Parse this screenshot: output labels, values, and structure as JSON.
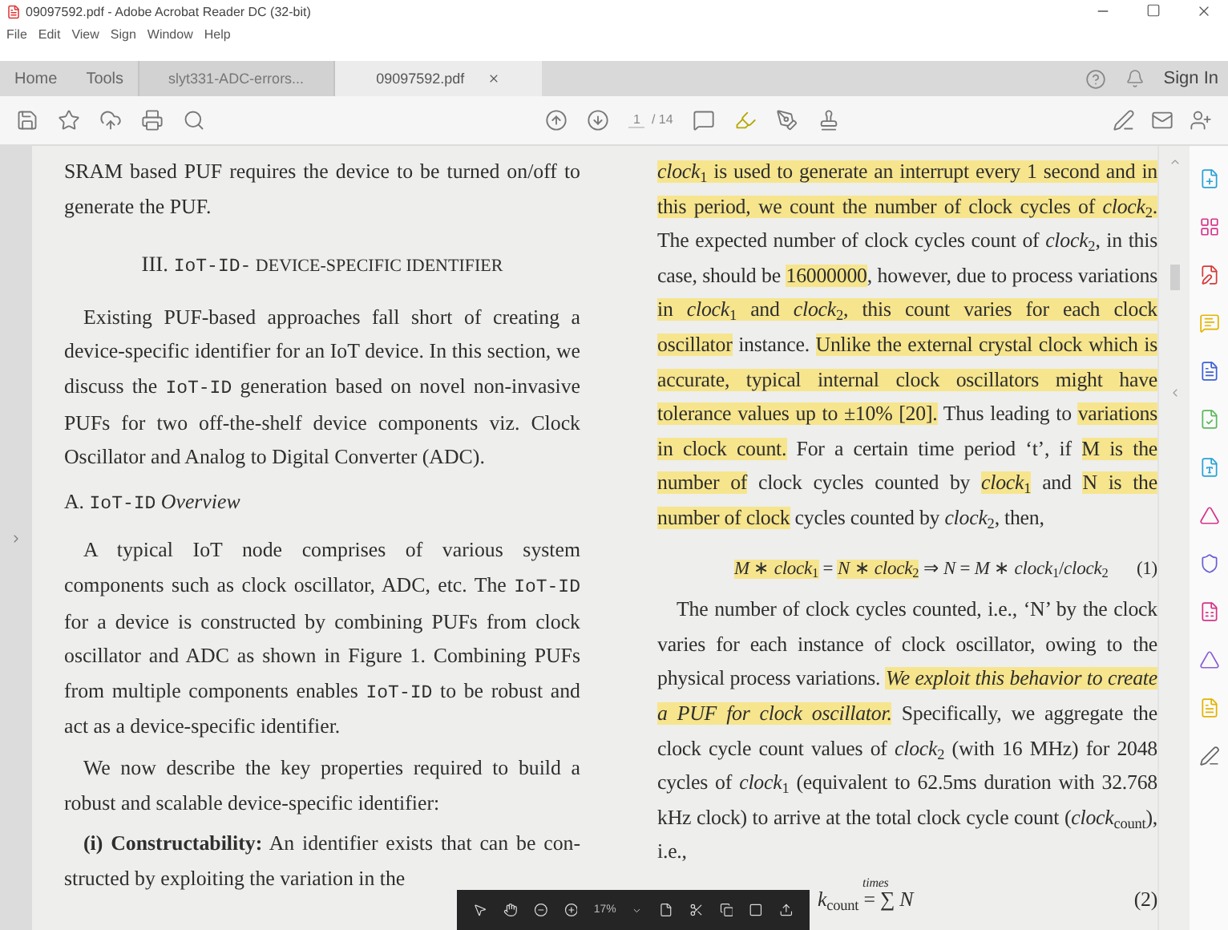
{
  "window": {
    "title": "09097592.pdf - Adobe Acrobat Reader DC (32-bit)"
  },
  "menu": [
    "File",
    "Edit",
    "View",
    "Sign",
    "Window",
    "Help"
  ],
  "nav": [
    "Home",
    "Tools"
  ],
  "tabs": [
    {
      "label": "slyt331-ADC-errors...",
      "selected": false
    },
    {
      "label": "09097592.pdf",
      "selected": true
    }
  ],
  "sign_in": "Sign In",
  "page_nav": {
    "current": "1",
    "total": "/ 14"
  },
  "document": {
    "left_column": [
      {
        "kind": "paragraph",
        "indent": false,
        "runs": [
          {
            "text": "SRAM based PUF requires the device to be turned on/off to generate the PUF.",
            "kind": "plain"
          }
        ]
      },
      {
        "kind": "heading",
        "runs": [
          {
            "text": "III. ",
            "kind": "plain"
          },
          {
            "text": "IoT-ID-",
            "kind": "mono"
          },
          {
            "text": " DEVICE-SPECIFIC IDENTIFIER",
            "kind": "caps"
          }
        ]
      },
      {
        "kind": "paragraph",
        "indent": true,
        "runs": [
          {
            "text": "Existing PUF-based approaches fall short of creating a device-specific identifier for an IoT device. In this section, we discuss the ",
            "kind": "plain"
          },
          {
            "text": "IoT-ID",
            "kind": "mono"
          },
          {
            "text": " generation based on novel non-invasive PUFs for two off-the-shelf device components viz. Clock Oscillator and Analog to Digital Converter (ADC).",
            "kind": "plain"
          }
        ]
      },
      {
        "kind": "subheading",
        "runs": [
          {
            "text": "A. ",
            "kind": "plain"
          },
          {
            "text": "IoT-ID",
            "kind": "mono"
          },
          {
            "text": " Overview",
            "kind": "italic"
          }
        ]
      },
      {
        "kind": "paragraph",
        "indent": true,
        "runs": [
          {
            "text": "A typical IoT node comprises of various system components such as clock oscillator, ADC, etc. The ",
            "kind": "plain"
          },
          {
            "text": "IoT-ID",
            "kind": "mono"
          },
          {
            "text": " for a device is constructed by combining PUFs from clock oscillator and ADC as shown in Figure 1. Combining PUFs from multiple components enables ",
            "kind": "plain"
          },
          {
            "text": "IoT-ID",
            "kind": "mono"
          },
          {
            "text": " to be robust and act as a device-specific identifier.",
            "kind": "plain"
          }
        ]
      },
      {
        "kind": "paragraph",
        "indent": true,
        "runs": [
          {
            "text": "We now describe the key properties required to build a robust and scalable device-specific identifier:",
            "kind": "plain"
          }
        ]
      },
      {
        "kind": "paragraph",
        "indent": true,
        "runs": [
          {
            "text": "(i) Constructability:",
            "kind": "bold"
          },
          {
            "text": " An identifier exists that can be con-structed by exploiting the variation in the",
            "kind": "plain"
          }
        ]
      }
    ],
    "right_column": [
      {
        "kind": "paragraph",
        "indent": false,
        "runs": [
          {
            "text": "*clock*$_{1}$ is used to generate an interrupt every 1 second and in this period, we count the number of clock cycles of *clock*$_{2}$.",
            "kind": "plain",
            "highlighted": true
          },
          {
            "text": " The expected number of clock cycles count of *clock*$_{2}$, in this case, should be ",
            "kind": "plain",
            "highlighted": false
          },
          {
            "text": "16000000",
            "kind": "plain",
            "highlighted": true
          },
          {
            "text": ", however, due to process variations ",
            "kind": "plain",
            "highlighted": false
          },
          {
            "text": "in *clock*$_{1}$ and *clock*$_{2}$, this count varies for each clock oscillator",
            "kind": "plain",
            "highlighted": true
          },
          {
            "text": " instance. ",
            "kind": "plain",
            "highlighted": false
          },
          {
            "text": "Unlike the external crystal clock which is accurate, typical internal clock oscillators might have tolerance values up to ±10% [20].",
            "kind": "plain",
            "highlighted": true
          },
          {
            "text": " Thus leading to ",
            "kind": "plain",
            "highlighted": false
          },
          {
            "text": "variations in clock count.",
            "kind": "plain",
            "highlighted": true
          },
          {
            "text": " For a certain time period ‘t’, if ",
            "kind": "plain",
            "highlighted": false
          },
          {
            "text": "M is the number of",
            "kind": "plain",
            "highlighted": true
          },
          {
            "text": " clock cycles counted by ",
            "kind": "plain",
            "highlighted": false
          },
          {
            "text": "*clock*$_{1}$",
            "kind": "plain",
            "highlighted": true
          },
          {
            "text": " and ",
            "kind": "plain",
            "highlighted": false
          },
          {
            "text": "N is the number of clock",
            "kind": "plain",
            "highlighted": true
          },
          {
            "text": " cycles counted by *clock*$_{2}$, then,",
            "kind": "plain",
            "highlighted": false
          }
        ]
      },
      {
        "kind": "equation",
        "number": "(1)",
        "runs": [
          {
            "text": "*M* ∗ *clock*$_{1}$",
            "kind": "plain",
            "highlighted": true
          },
          {
            "text": " = ",
            "kind": "plain",
            "highlighted": false
          },
          {
            "text": "*N* ∗ *clock*$_{2}$",
            "kind": "plain",
            "highlighted": true
          },
          {
            "text": " ⇒    *N* = *M* ∗ *clock*$_{1}$/*clock*$_{2}$",
            "kind": "plain",
            "highlighted": false
          }
        ]
      },
      {
        "kind": "paragraph",
        "indent": true,
        "runs": [
          {
            "text": "The number of clock cycles counted, i.e., ‘N’ by the clock varies for each instance of clock oscillator, owing to the physical process variations. ",
            "kind": "plain",
            "highlighted": false
          },
          {
            "text": "We exploit this behavior to create a PUF for clock oscillator.",
            "kind": "italic",
            "highlighted": true
          },
          {
            "text": " Specifically, we aggregate the clock cycle count values of *clock*$_{2}$ (with 16 MHz) for 2048 cycles of *clock*$_{1}$ (equivalent to 62.5ms duration with 32.768 kHz clock) to arrive at the total clock cycle count (*clock*$_{count}$), i.e.,",
            "kind": "plain",
            "highlighted": false
          }
        ]
      },
      {
        "kind": "sum_equation",
        "above": "times",
        "number": "(2)",
        "runs": [
          {
            "text": "*k*$_{count}$ = ∑ *N*",
            "kind": "plain",
            "highlighted": false
          }
        ]
      }
    ]
  },
  "zoom_toolbar": {
    "zoom": "17%"
  }
}
